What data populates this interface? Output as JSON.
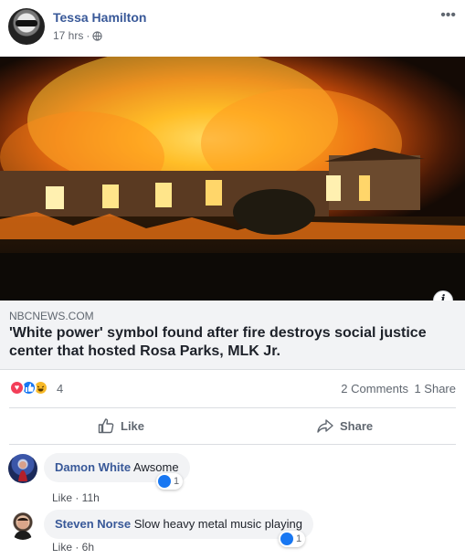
{
  "post": {
    "author": "Tessa Hamilton",
    "time": "17 hrs",
    "separator": "·",
    "more": "•••"
  },
  "link": {
    "domain": "NBCNEWS.COM",
    "title": "'White power' symbol found after fire destroys social justice center that hosted Rosa Parks, MLK Jr.",
    "info": "i"
  },
  "reactions": {
    "count": "4",
    "comments": "2 Comments",
    "shares": "1 Share"
  },
  "actions": {
    "like": "Like",
    "share": "Share"
  },
  "comments": [
    {
      "name": "Damon White",
      "text": "Awsome",
      "actions": "Like · 11h",
      "reactions": "1"
    },
    {
      "name": "Steven Norse",
      "text": "Slow heavy metal music playing",
      "actions": "Like · 6h",
      "reactions": "1"
    }
  ],
  "colors": {
    "link_blue": "#385898",
    "like_blue": "#1877f2",
    "love_red": "#f33e58",
    "haha_yellow": "#f7b928"
  },
  "icons": [
    "globe-icon",
    "more-icon",
    "love-reaction-icon",
    "like-reaction-icon",
    "haha-reaction-icon",
    "thumbs-up-icon",
    "share-arrow-icon",
    "info-icon"
  ]
}
